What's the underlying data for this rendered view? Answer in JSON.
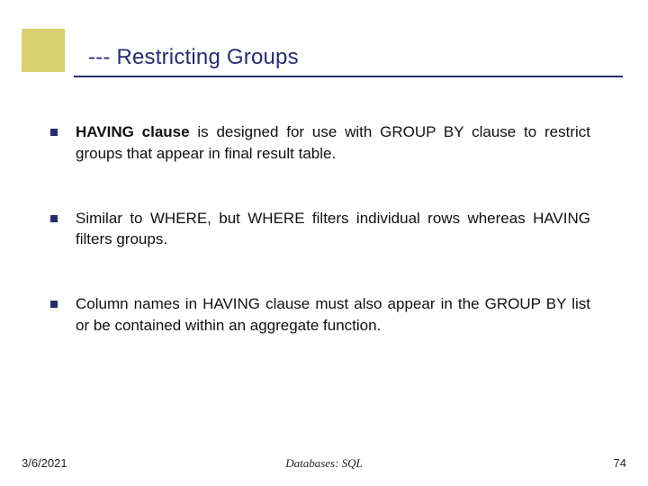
{
  "title": "--- Restricting Groups",
  "bullets": [
    {
      "bold": "HAVING clause",
      "rest": " is designed for use with GROUP BY clause to restrict groups that appear in final result table."
    },
    {
      "bold": "",
      "rest": "Similar to WHERE, but WHERE filters individual rows whereas HAVING filters groups."
    },
    {
      "bold": "",
      "rest": "Column names in HAVING clause must also appear in the GROUP BY list or be contained within an aggregate function."
    }
  ],
  "footer": {
    "left": "3/6/2021",
    "center": "Databases: SQL",
    "right": "74"
  }
}
